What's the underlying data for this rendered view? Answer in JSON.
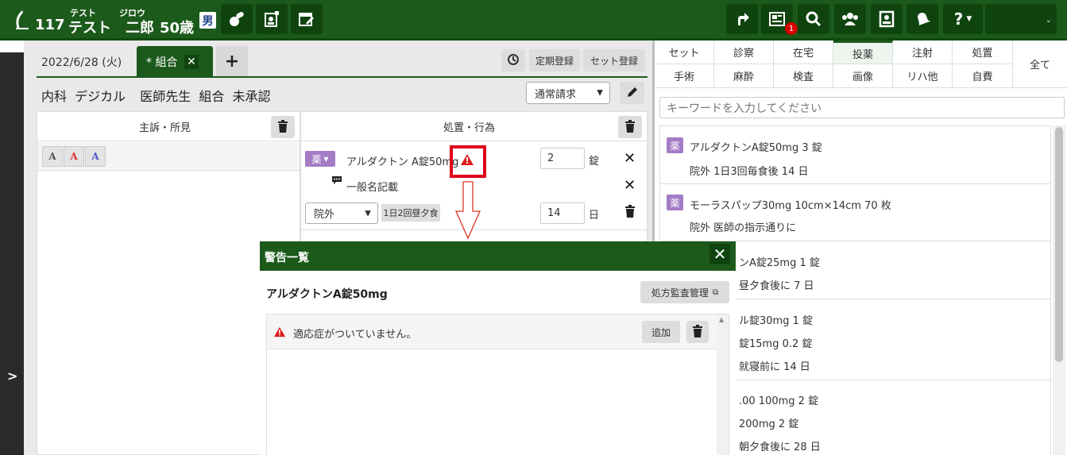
{
  "header": {
    "patient_id": "117",
    "family_kana": "テスト",
    "given_kana": "ジロウ",
    "family_name": "テスト",
    "given_name": "二郎",
    "age": "50歳",
    "sex": "男",
    "notification_count": "1",
    "help_label": "?",
    "header_colors": {
      "bar": "#1c5a1c",
      "button": "#0f440f",
      "badge": "#d60000"
    }
  },
  "record": {
    "date": "2022/6/28 (火)",
    "active_tab": "* 組合",
    "add_tab_label": "+",
    "history_icon": "clock-icon",
    "regular_label": "定期登録",
    "set_label": "セット登録",
    "info": [
      "内科",
      "デジカル",
      "医師先生",
      "組合",
      "未承認"
    ],
    "billing_select": "通常請求"
  },
  "complaint": {
    "title": "主訴・所見"
  },
  "treatment": {
    "title": "処置・行為",
    "drug_tag": "薬",
    "drug_name": "アルダクトン A錠50mg",
    "qty": "2",
    "qty_unit": "錠",
    "generic_note": "一般名記載",
    "route": "院外",
    "timing": "1日2回昼夕食",
    "days": "14",
    "days_unit": "日"
  },
  "right": {
    "tabs_row1": [
      "セット",
      "診察",
      "在宅",
      "投薬",
      "注射",
      "処置"
    ],
    "tabs_row2": [
      "手術",
      "麻酔",
      "検査",
      "画像",
      "リハ他",
      "自費"
    ],
    "all_tab": "全て",
    "active_tab": "投薬",
    "search_placeholder": "キーワードを入力してください",
    "items": [
      {
        "tag": "薬",
        "line1": "アルダクトンA錠50mg 3 錠",
        "line2": "院外 1日3回毎食後 14 日"
      },
      {
        "tag": "薬",
        "line1": "モーラスパップ30mg 10cm×14cm 70 枚",
        "line2": "院外 医師の指示通りに"
      },
      {
        "line1": "ンA錠25mg 1 錠",
        "line2": "昼夕食後に 7 日"
      },
      {
        "line1": "ル錠30mg 1 錠",
        "line2": "錠15mg 0.2 錠",
        "line3": "就寝前に 14 日"
      },
      {
        "line1": ".00 100mg 2 錠",
        "line2": "200mg 2 錠",
        "line3": "朝夕食後に 28 日"
      }
    ]
  },
  "dialog": {
    "title": "警告一覧",
    "drug_name": "アルダクトンA錠50mg",
    "audit_button": "処方監査管理",
    "warning": "適応症がついていません。",
    "add_button": "追加"
  }
}
